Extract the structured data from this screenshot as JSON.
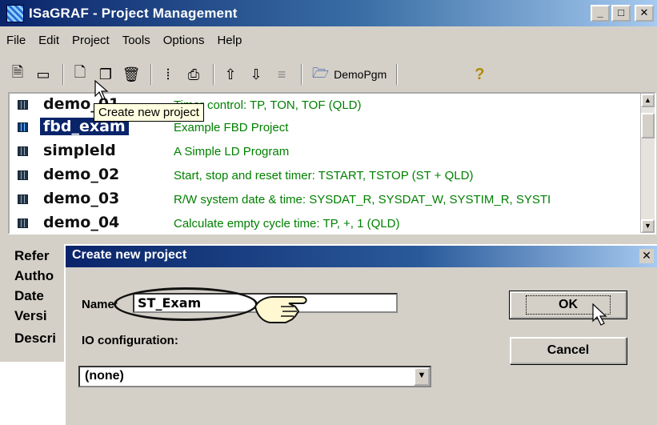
{
  "window": {
    "title": "ISaGRAF - Project Management",
    "controls": [
      "_",
      "□",
      "✕"
    ]
  },
  "menu": [
    "File",
    "Edit",
    "Project",
    "Tools",
    "Options",
    "Help"
  ],
  "toolbar": {
    "demo_label": "DemoPgm"
  },
  "tooltip": "Create new project",
  "projects": [
    {
      "name": "demo_01",
      "description": "Timer control:  TP, TON, TOF  (QLD)"
    },
    {
      "name": "fbd_exam",
      "description": "Example FBD Project"
    },
    {
      "name": "simpleld",
      "description": "A Simple LD Program"
    },
    {
      "name": "demo_02",
      "description": "Start, stop and reset timer:  TSTART, TSTOP  (ST + QLD)"
    },
    {
      "name": "demo_03",
      "description": "R/W system date & time:  SYSDAT_R, SYSDAT_W, SYSTIM_R, SYSTI"
    },
    {
      "name": "demo_04",
      "description": "Calculate empty cycle time:  TP, +, 1  (QLD)"
    }
  ],
  "properties": [
    "Refer",
    "Autho",
    "Date",
    "Versi",
    "Descri"
  ],
  "dialog": {
    "title": "Create new project",
    "name_label": "Name:",
    "name_value": "ST_Exam",
    "io_label": "IO configuration:",
    "io_value": "(none)",
    "ok_label": "OK",
    "cancel_label": "Cancel"
  },
  "colors": {
    "title_bar": "#0a246a",
    "description_text": "#008000",
    "selection": "#0a246a",
    "tooltip_bg": "#ffffe1"
  }
}
